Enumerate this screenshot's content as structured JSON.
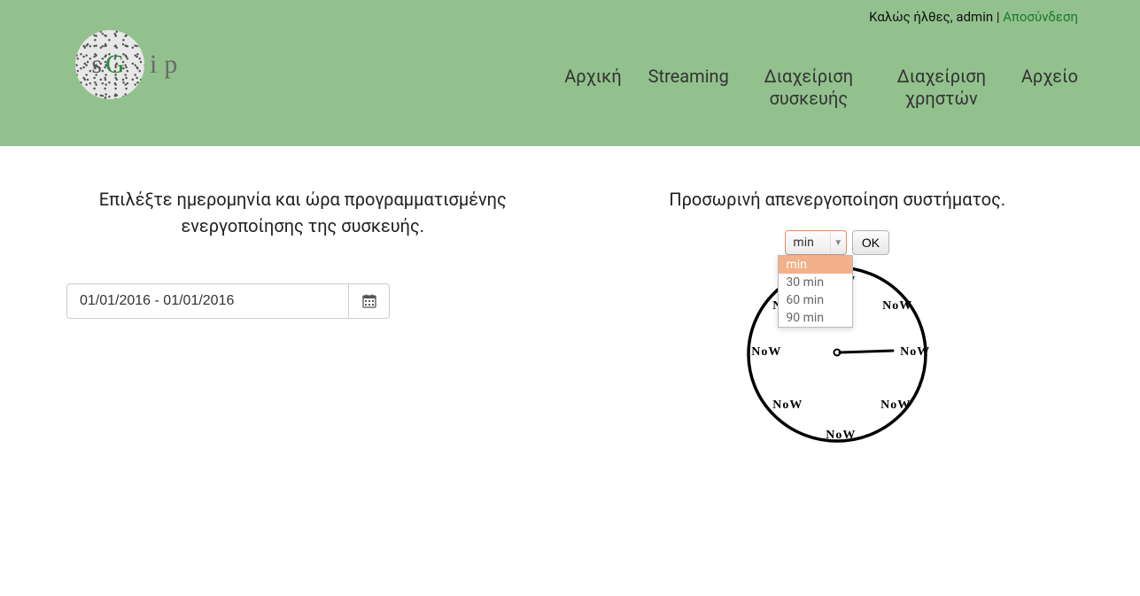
{
  "topbar": {
    "welcome": "Καλώς ήλθες, admin",
    "separator": " | ",
    "logout": "Αποσύνδεση"
  },
  "logo": {
    "s": "s",
    "g": "G",
    "suffix": "ip"
  },
  "nav": {
    "home": "Αρχική",
    "streaming": "Streaming",
    "device": "Διαχείριση συσκευής",
    "users": "Διαχείριση χρηστών",
    "archive": "Αρχείο"
  },
  "left": {
    "heading": "Επιλέξτε ημερομηνία και ώρα προγραμματισμένης ενεργοποίησης της συσκευής.",
    "date_value": "01/01/2016 - 01/01/2016"
  },
  "right": {
    "heading": "Προσωρινή απενεργοποίηση συστήματος.",
    "select_value": "min",
    "ok_label": "OK",
    "options": {
      "o0": "min",
      "o1": "30 min",
      "o2": "60 min",
      "o3": "90 min"
    },
    "clock_label": "NoW"
  }
}
